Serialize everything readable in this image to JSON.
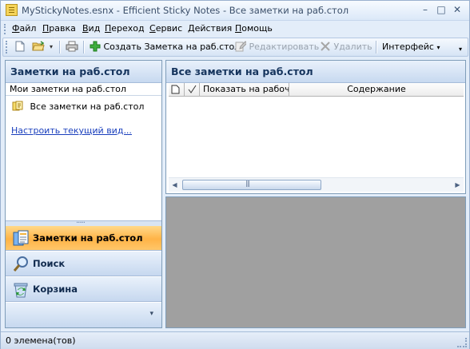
{
  "window": {
    "title": "MyStickyNotes.esnx - Efficient Sticky Notes - Все заметки на раб.стол",
    "minimize": "–",
    "maximize": "□",
    "close": "✕"
  },
  "menu": [
    {
      "accel": "Ф",
      "rest": "айл"
    },
    {
      "accel": "П",
      "rest": "равка"
    },
    {
      "accel": "В",
      "rest": "ид"
    },
    {
      "accel": "П",
      "rest": "ереход"
    },
    {
      "accel": "С",
      "rest": "ервис"
    },
    {
      "accel": "Д",
      "rest": "ействия"
    },
    {
      "accel": "П",
      "rest": "омощь"
    }
  ],
  "toolbar": {
    "create_label": "Создать Заметка на раб.стол",
    "edit_label": "Редактировать",
    "delete_label": "Удалить",
    "interface_label": "Интерфейс",
    "dropdown_glyph": "▾",
    "overflow_glyph": "▾"
  },
  "left_pane": {
    "header": "Заметки на раб.стол",
    "subheader": "Мои заметки на раб.стол",
    "folder_item": "Все заметки на раб.стол",
    "customize_link": "Настроить текущий вид..."
  },
  "navigation": {
    "buttons": [
      {
        "label": "Заметки на раб.стол",
        "icon": "notes-icon",
        "active": true
      },
      {
        "label": "Поиск",
        "icon": "search-icon",
        "active": false
      },
      {
        "label": "Корзина",
        "icon": "recycle-bin-icon",
        "active": false
      }
    ],
    "footer_glyph": "▾"
  },
  "right_pane": {
    "header": "Все заметки на раб.стол",
    "columns": [
      "Показать на рабоче",
      "Содержание"
    ]
  },
  "statusbar": {
    "text": "0 элемена(тов)"
  },
  "colors": {
    "accent_active": "#ffb347",
    "header_text": "#15345d",
    "link": "#1a3fbd",
    "preview_bg": "#a0a0a0"
  }
}
